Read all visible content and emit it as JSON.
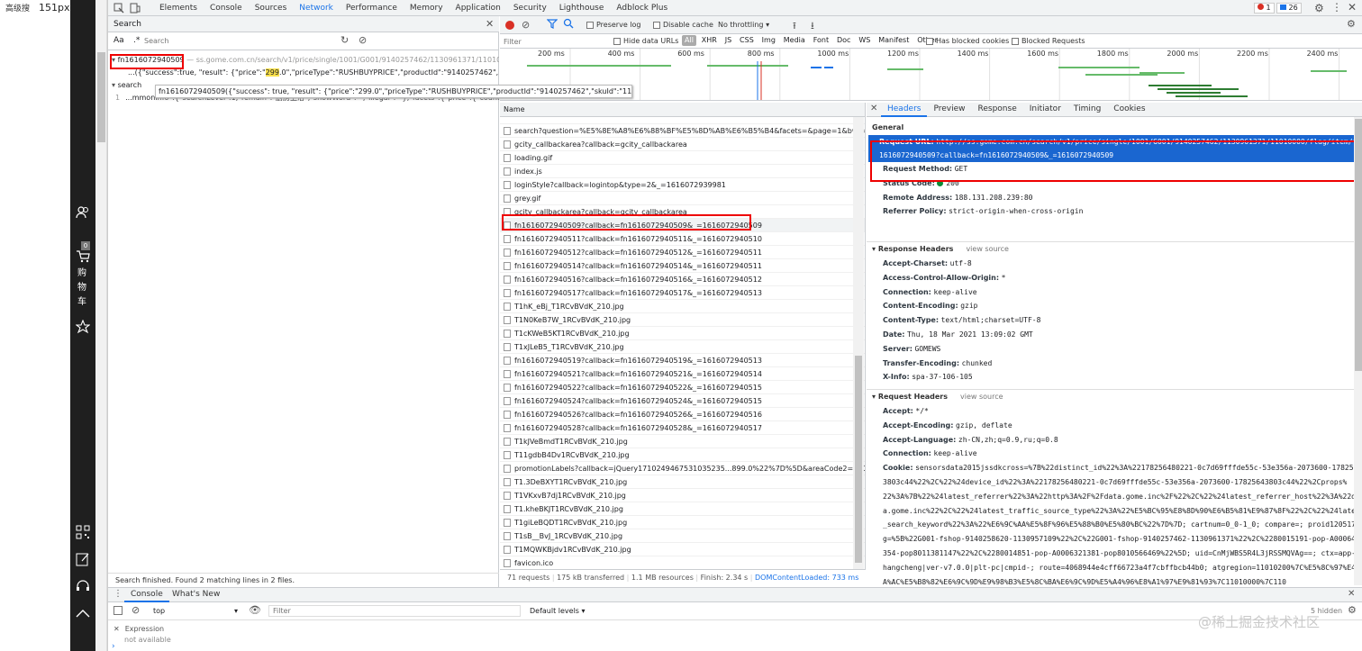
{
  "page": {
    "corner_text": "高级搜",
    "dims": "151px × 937px"
  },
  "sidebar": {
    "cart_count": "0",
    "cart_label_1": "购",
    "cart_label_2": "物",
    "cart_label_3": "车"
  },
  "devtools": {
    "tabs": [
      "Elements",
      "Console",
      "Sources",
      "Network",
      "Performance",
      "Memory",
      "Application",
      "Security",
      "Lighthouse",
      "Adblock Plus"
    ],
    "active_tab": "Network",
    "errors": "1",
    "messages": "26"
  },
  "search_panel": {
    "title": "Search",
    "aa": "Aa",
    "regex": ".*",
    "placeholder": "Search",
    "result1_file": "fn1616072940509",
    "result1_url": "— ss.gome.com.cn/search/v1/price/single/1001/G001/9140257462/1130961371/11010000/f...",
    "result1_line_prefix": "...({\"success\":true, \"result\": {\"price\":\"",
    "result1_highlight": "299",
    "result1_line_suffix": ".0\",\"priceType\":\"RUSHBUYPRICE\",\"productId\":\"9140257462\",\"skuId\":\"...",
    "tooltip": "fn1616072940509({\"success\": true, \"result\": {\"price\":\"299.0\",\"priceType\":\"RUSHBUYPRICE\",\"productId\":\"9140257462\",\"skuId\":\"1130961371\"}})",
    "result2_file": "search",
    "result2_num": "1",
    "result2_line": "...mmonInfo\":{\"searchLevel\":1,\"remain\":\"厨房卫浴\",\"showWord\":\"\",\"illegal\":\"\"},\"facets\":{\"price\":{\"count\":0,\"inde...",
    "status": "Search finished.  Found 2 matching lines in 2 files."
  },
  "network_toolbar": {
    "preserve_log": "Preserve log",
    "disable_cache": "Disable cache",
    "throttling": "No throttling"
  },
  "filter_bar": {
    "placeholder": "Filter",
    "hide_data_urls": "Hide data URLs",
    "types": [
      "All",
      "XHR",
      "JS",
      "CSS",
      "Img",
      "Media",
      "Font",
      "Doc",
      "WS",
      "Manifest",
      "Other"
    ],
    "has_blocked": "Has blocked cookies",
    "blocked_requests": "Blocked Requests"
  },
  "timeline": {
    "ticks": [
      "200 ms",
      "400 ms",
      "600 ms",
      "800 ms",
      "1000 ms",
      "1200 ms",
      "1400 ms",
      "1600 ms",
      "1800 ms",
      "2000 ms",
      "2200 ms",
      "2400 ms"
    ]
  },
  "requests": {
    "column": "Name",
    "items": [
      "search?question=%E5%8E%A8%E6%88%BF%E5%8D%AB%E6%B5%B4&facets=&page=1&bws=0&t",
      "gcity_callbackarea?callback=gcity_callbackarea",
      "loading.gif",
      "index.js",
      "loginStyle?callback=logintop&type=2&_=1616072939981",
      "grey.gif",
      "gcity_callbackarea?callback=gcity_callbackarea",
      "fn1616072940509?callback=fn1616072940509&_=1616072940509",
      "fn1616072940511?callback=fn1616072940511&_=1616072940510",
      "fn1616072940512?callback=fn1616072940512&_=1616072940511",
      "fn1616072940514?callback=fn1616072940514&_=1616072940511",
      "fn1616072940516?callback=fn1616072940516&_=1616072940512",
      "fn1616072940517?callback=fn1616072940517&_=1616072940513",
      "T1hK_eBj_T1RCvBVdK_210.jpg",
      "T1N0KeB7W_1RCvBVdK_210.jpg",
      "T1cKWeB5KT1RCvBVdK_210.jpg",
      "T1xJLeB5_T1RCvBVdK_210.jpg",
      "fn1616072940519?callback=fn1616072940519&_=1616072940513",
      "fn1616072940521?callback=fn1616072940521&_=1616072940514",
      "fn1616072940522?callback=fn1616072940522&_=1616072940515",
      "fn1616072940524?callback=fn1616072940524&_=1616072940515",
      "fn1616072940526?callback=fn1616072940526&_=1616072940516",
      "fn1616072940528?callback=fn1616072940528&_=1616072940517",
      "T1kJVeBmdT1RCvBVdK_210.jpg",
      "T11gdbB4Dv1RCvBVdK_210.jpg",
      "promotionLabels?callback=jQuery1710249467531035235...899.0%22%7D%5D&areaCode2=110100",
      "T1.3DeBXYT1RCvBVdK_210.jpg",
      "T1VKxvB7dj1RCvBVdK_210.jpg",
      "T1.kheBKJT1RCvBVdK_210.jpg",
      "T1giLeBQDT1RCvBVdK_210.jpg",
      "T1sB__BvJ_1RCvBVdK_210.jpg",
      "T1MQWKBjdv1RCvBVdK_210.jpg",
      "favicon.ico"
    ],
    "selected_index": 7
  },
  "status_bar": {
    "requests": "71 requests",
    "transferred": "175 kB transferred",
    "resources": "1.1 MB resources",
    "finish": "Finish: 2.34 s",
    "dcl": "DOMContentLoaded: 733 ms"
  },
  "detail": {
    "tabs": [
      "Headers",
      "Preview",
      "Response",
      "Initiator",
      "Timing",
      "Cookies"
    ],
    "active_tab": "Headers",
    "general_title": "General",
    "request_url_key": "Request URL:",
    "request_url_val": "http://ss.gome.com.cn/search/v1/price/single/1001/G001/9140257462/1130961371/11010000/flag/item/fn1616072940509?callback=fn1616072940509&_=1616072940509",
    "general": [
      {
        "k": "Request Method:",
        "v": "GET"
      },
      {
        "k": "Status Code:",
        "v": "200"
      },
      {
        "k": "Remote Address:",
        "v": "188.131.208.239:80"
      },
      {
        "k": "Referrer Policy:",
        "v": "strict-origin-when-cross-origin"
      }
    ],
    "response_title": "Response Headers",
    "view_source": "view source",
    "response": [
      {
        "k": "Accept-Charset:",
        "v": "utf-8"
      },
      {
        "k": "Access-Control-Allow-Origin:",
        "v": "*"
      },
      {
        "k": "Connection:",
        "v": "keep-alive"
      },
      {
        "k": "Content-Encoding:",
        "v": "gzip"
      },
      {
        "k": "Content-Type:",
        "v": "text/html;charset=UTF-8"
      },
      {
        "k": "Date:",
        "v": "Thu, 18 Mar 2021 13:09:02 GMT"
      },
      {
        "k": "Server:",
        "v": "GOMEWS"
      },
      {
        "k": "Transfer-Encoding:",
        "v": "chunked"
      },
      {
        "k": "X-Info:",
        "v": "spa-37-106-105"
      }
    ],
    "request_title": "Request Headers",
    "request": [
      {
        "k": "Accept:",
        "v": "*/*"
      },
      {
        "k": "Accept-Encoding:",
        "v": "gzip, deflate"
      },
      {
        "k": "Accept-Language:",
        "v": "zh-CN,zh;q=0.9,ru;q=0.8"
      },
      {
        "k": "Connection:",
        "v": "keep-alive"
      }
    ],
    "cookie_key": "Cookie:",
    "cookie_lines": [
      "sensorsdata2015jssdkcross=%7B%22distinct_id%22%3A%22178256480221-0c7d69fffde55c-53e356a-2073600-1782564",
      "3803c44%22%2C%22%24device_id%22%3A%22178256480221-0c7d69fffde55c-53e356a-2073600-17825643803c44%22%2Cprops%",
      "22%3A%7B%22%24latest_referrer%22%3A%22http%3A%2F%2Fdata.gome.inc%2F%22%2C%22%24latest_referrer_host%22%3A%22dat",
      "a.gome.inc%22%2C%22%24latest_traffic_source_type%22%3A%22%E5%BC%95%E8%8D%90%E6%B5%81%E9%87%8F%22%2C%22%24latest",
      "_search_keyword%22%3A%22%E6%9C%AA%E5%8F%96%E5%88%B0%E5%80%BC%22%7D%7D; cartnum=0_0-1_0; compare=; proid120517at",
      "g=%5B%22G001-fshop-9140258620-1130957109%22%2C%22G001-fshop-9140257462-1130961371%22%2C%2280015191-pop-A0006428",
      "354-pop8011381147%22%2C%2280014851-pop-A0006321381-pop8010566469%22%5D; uid=CnMjWBS5R4L3jRSSMQVAg==; ctx=app-s",
      "hangcheng|ver-v7.0.0|plt-pc|cmpid-; route=4068944e4cff66723a4f7cbffbcb44b0; atgregion=11010200%7C%E5%8C%97%E4%B",
      "A%AC%E5%B8%82%E6%9C%9D%E9%98%B3%E5%8C%BA%E6%9C%9D%E5%A4%96%E8%A1%97%E9%81%93%7C11010000%7C110",
      "00000%7C110102002; _idusin=85994384213; s_cc=true; gpv_pn=no%20value; gpv_p22=no%20value; s_getNewRepeat=161607"
    ]
  },
  "drawer": {
    "tabs": [
      "Console",
      "What's New"
    ],
    "context": "top",
    "filter_placeholder": "Filter",
    "levels": "Default levels",
    "hidden": "5 hidden",
    "expression": "Expression",
    "not_available": "not available"
  },
  "watermark": "@稀土掘金技术社区"
}
